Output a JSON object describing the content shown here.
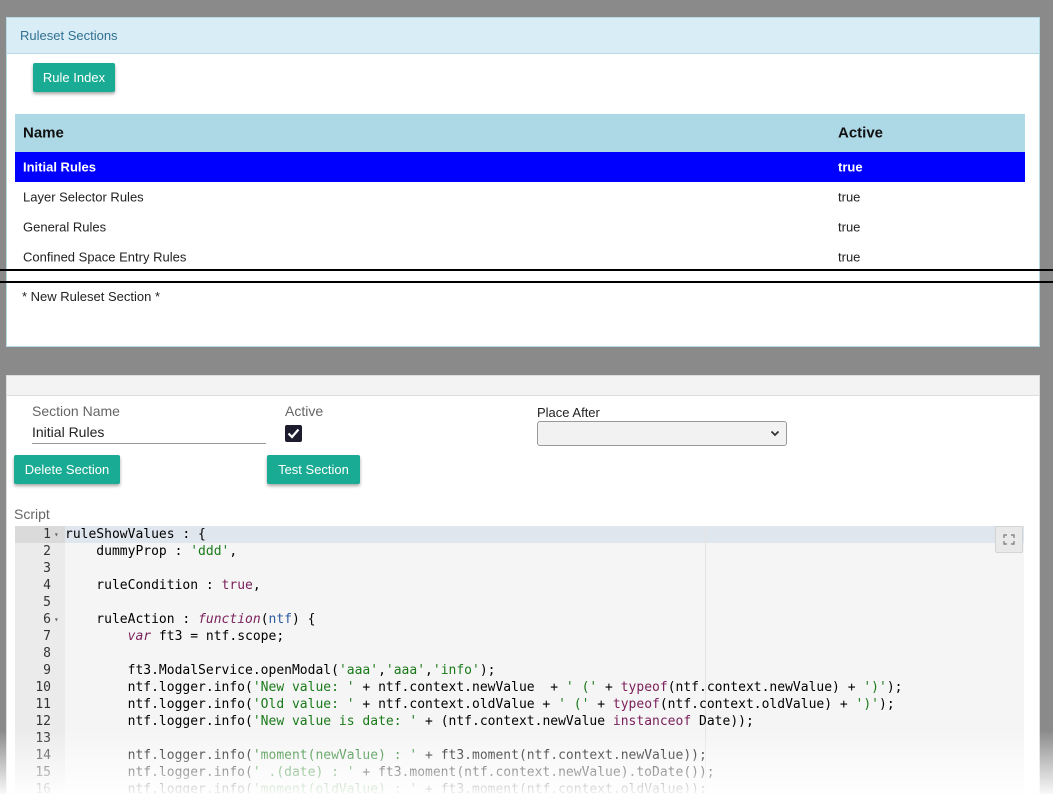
{
  "ruleset_panel": {
    "title": "Ruleset Sections",
    "rule_index_button": "Rule Index",
    "columns": {
      "name": "Name",
      "active": "Active"
    },
    "rows": [
      {
        "name": "Initial Rules",
        "active": "true",
        "selected": true
      },
      {
        "name": "Layer Selector Rules",
        "active": "true",
        "selected": false
      },
      {
        "name": "General Rules",
        "active": "true",
        "selected": false
      },
      {
        "name": "Confined Space Entry Rules",
        "active": "true",
        "selected": false
      }
    ],
    "new_section_label": "* New Ruleset Section *"
  },
  "editor_panel": {
    "section_name_label": "Section Name",
    "section_name_value": "Initial Rules",
    "active_label": "Active",
    "active_checked": true,
    "place_after_label": "Place After",
    "place_after_value": "",
    "delete_button": "Delete Section",
    "test_button": "Test Section",
    "script_label": "Script"
  },
  "script": {
    "line_numbers": [
      "1",
      "2",
      "3",
      "4",
      "5",
      "6",
      "7",
      "8",
      "9",
      "10",
      "11",
      "12",
      "13",
      "14",
      "15",
      "16"
    ],
    "fold_lines": [
      1,
      6
    ],
    "lines": [
      "ruleShowValues : {",
      "    dummyProp : 'ddd',",
      "",
      "    ruleCondition : true,",
      "",
      "    ruleAction : function(ntf) {",
      "        var ft3 = ntf.scope;",
      "",
      "        ft3.ModalService.openModal('aaa','aaa','info');",
      "        ntf.logger.info('New value: ' + ntf.context.newValue  + ' (' + typeof(ntf.context.newValue) + ')');",
      "        ntf.logger.info('Old value: ' + ntf.context.oldValue + ' (' + typeof(ntf.context.oldValue) + ')');",
      "        ntf.logger.info('New value is date: ' + (ntf.context.newValue instanceof Date));",
      "",
      "        ntf.logger.info('moment(newValue) : ' + ft3.moment(ntf.context.newValue));",
      "        ntf.logger.info(' .(date) : ' + ft3.moment(ntf.context.newValue).toDate());",
      "        ntf.logger.info('moment(oldValue) : ' + ft3.moment(ntf.context.oldValue));"
    ]
  },
  "colors": {
    "button": "#1aab94",
    "selected_row": "#0000ff",
    "table_header": "#add8e6",
    "panel_header": "#d9edf7"
  },
  "icons": {
    "fullscreen": "fullscreen-icon",
    "chevron": "chevron-down-icon",
    "check": "check-icon"
  }
}
